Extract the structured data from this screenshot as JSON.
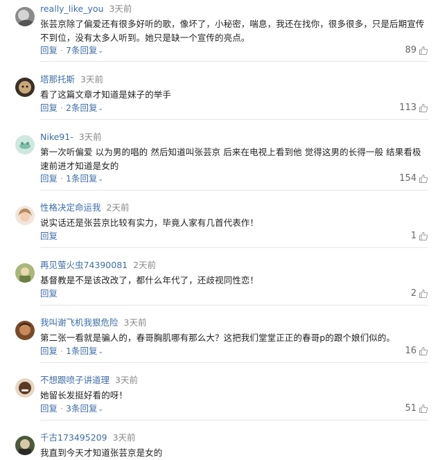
{
  "comments": [
    {
      "username": "really_like_you",
      "time": "3天前",
      "text": "张芸京除了偏爱还有很多好听的歌，像坏了，小秘密，喘息，我还在找你，很多很多，只是后期宣传不到位，没有太多人听到。她只是缺一个宣传的亮点。",
      "reply_label": "回复",
      "replies_label": "7条回复",
      "likes": "89"
    },
    {
      "username": "塔那托斯",
      "time": "3天前",
      "text": "看了这篇文章才知道是妹子的举手",
      "reply_label": "回复",
      "replies_label": "2条回复",
      "likes": "113"
    },
    {
      "username": "Nike91-",
      "time": "3天前",
      "text": "第一次听偏爱 以为男的唱的 然后知道叫张芸京 后来在电视上看到他 觉得这男的长得一般 结果看极速前进才知道是女的",
      "reply_label": "回复",
      "replies_label": "1条回复",
      "likes": "154"
    },
    {
      "username": "性格决定命运我",
      "time": "2天前",
      "text": "说实话还是张芸京比较有实力，毕竟人家有几首代表作！",
      "reply_label": "回复",
      "replies_label": "",
      "likes": "1"
    },
    {
      "username": "再见萤火虫74390081",
      "time": "2天前",
      "text": "基督教是不是该改改了，都什么年代了，还歧视同性恋！",
      "reply_label": "回复",
      "replies_label": "",
      "likes": "2"
    },
    {
      "username": "我叫谢飞机我狠危险",
      "time": "3天前",
      "text": "第二张一看就是骗人的，春哥胸肌哪有那么大？这把我们堂堂正正的春哥p的跟个娘们似的。",
      "reply_label": "回复",
      "replies_label": "1条回复",
      "likes": "16"
    },
    {
      "username": "不想跟喷子讲道理",
      "time": "3天前",
      "text": "她留长发挺好看的呀！",
      "reply_label": "回复",
      "replies_label": "3条回复",
      "likes": "51"
    },
    {
      "username": "千古173495209",
      "time": "3天前",
      "text": "我直到今天才知道张芸京是女的",
      "reply_label": "",
      "replies_label": "",
      "likes": ""
    }
  ],
  "icons": {
    "like": "thumbs-up-icon",
    "chevron": "chevron-down-icon",
    "avatar": "user-avatar"
  },
  "colors": {
    "username": "#3d6ea8",
    "action": "#3d6ea8",
    "time": "#888888",
    "text": "#222222",
    "likes": "#666666",
    "divider": "#e6e6e6"
  }
}
